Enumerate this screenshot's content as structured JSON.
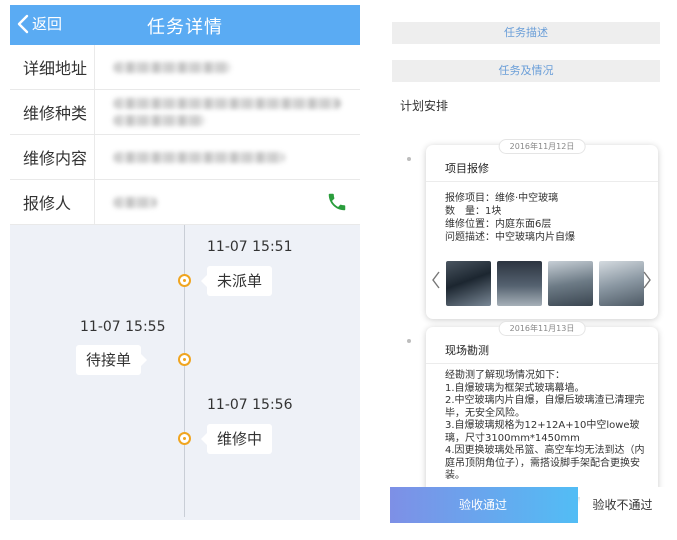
{
  "left": {
    "header": {
      "back_label": "返回",
      "title": "任务详情"
    },
    "rows": [
      {
        "label": "详细地址"
      },
      {
        "label": "维修种类"
      },
      {
        "label": "维修内容"
      },
      {
        "label": "报修人"
      }
    ],
    "timeline": [
      {
        "time": "11-07 15:51",
        "status": "未派单"
      },
      {
        "time": "11-07 15:55",
        "status": "待接单"
      },
      {
        "time": "11-07 15:56",
        "status": "维修中"
      }
    ],
    "colors": {
      "header": "#5aabf3",
      "accent_dot": "#f0a520",
      "phone_icon": "#2a9d3c"
    }
  },
  "right": {
    "tabs": [
      "任务描述",
      "任务及情况"
    ],
    "plan_title": "计划安排",
    "card1": {
      "date": "2016年11月12日",
      "title": "项目报修",
      "lines": [
        {
          "key": "报修项目：",
          "value": "维修·中空玻璃"
        },
        {
          "key": "数　量：",
          "value": "1块"
        },
        {
          "key": "维修位置：",
          "value": "内庭东面6层"
        },
        {
          "key": "问题描述：",
          "value": "中空玻璃内片自爆"
        }
      ]
    },
    "card2": {
      "date": "2016年11月13日",
      "title": "现场勘测",
      "paragraph": [
        "经勘测了解现场情况如下：",
        "1.自爆玻璃为框架式玻璃幕墙。",
        "2.中空玻璃内片自爆，自爆后玻璃渣已清理完毕，无安全风险。",
        "3.自爆玻璃规格为12+12A+10中空lowe玻璃，尺寸3100mm*1450mm",
        "4.因更换玻璃处吊篮、高空车均无法到达（内庭吊顶阴角位子），需搭设脚手架配合更换安装。"
      ]
    },
    "buttons": {
      "pass": "验收通过",
      "fail": "验收不通过"
    }
  }
}
